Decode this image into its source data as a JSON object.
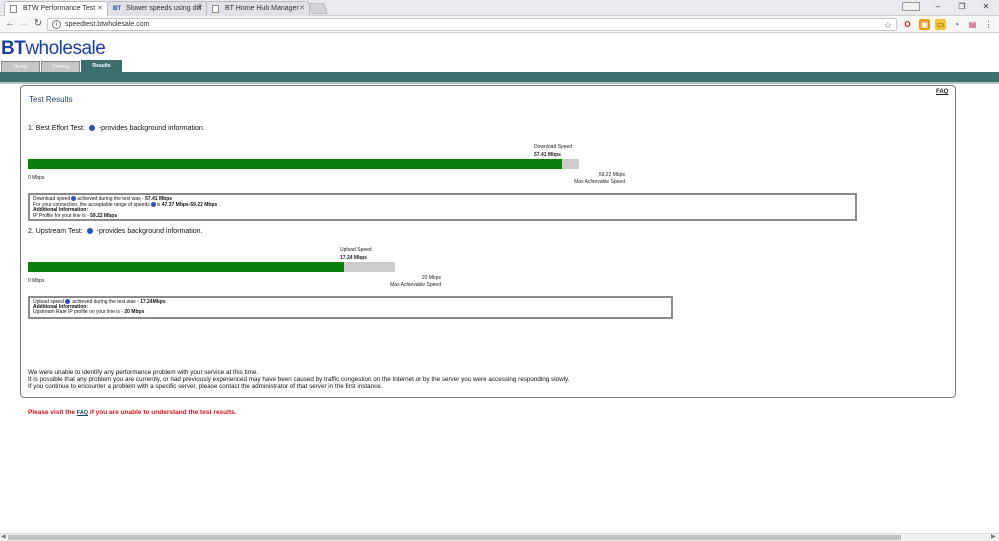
{
  "browser": {
    "tabs": [
      {
        "title": "BTW Performance Test",
        "favicon": "doc"
      },
      {
        "title": "Slower speeds using diff",
        "favicon": "BT"
      },
      {
        "title": "BT Home Hub Manager",
        "favicon": "doc"
      }
    ],
    "url": "speedtest.btwholesale.com"
  },
  "site": {
    "logo_bt": "BT",
    "logo_rest": "wholesale",
    "nav": [
      "Home",
      "Testing",
      "Results"
    ],
    "faq_top": "FAQ"
  },
  "results": {
    "title": "Test Results",
    "best_effort": {
      "heading": "1. Best Effort Test:",
      "heading_suffix": "-provides background information.",
      "speed_label": "Download Speed",
      "speed_value": "57.41 Mbps",
      "fill_fraction": 0.9688,
      "min_label": "0 Mbps",
      "max_value": "59.22 Mbps",
      "max_label": "Max Achievable Speed",
      "details": {
        "l1_pre": "Download speed",
        "l1_mid": "achieved during the test was - ",
        "l1_val": "57.41 Mbps",
        "l2_pre": "For your connection, the acceptable range of speeds",
        "l2_mid": "is ",
        "l2_val": "47.37 Mbps-59.22 Mbps",
        "l2_end": " .",
        "l3": "Additional Information:",
        "l4_pre": "IP Profile for your line is - ",
        "l4_val": "59.22 Mbps"
      }
    },
    "upstream": {
      "heading": "2. Upstream Test:",
      "heading_suffix": "-provides background information.",
      "speed_label": "Upload Speed",
      "speed_value": "17.24 Mbps",
      "fill_fraction": 0.862,
      "min_label": "0 Mbps",
      "max_value": "20 Mbps",
      "max_label": "Max Achievable Speed",
      "details": {
        "l1_pre": "Upload speed",
        "l1_mid": " achieved during the test was - ",
        "l1_val": "17.24Mbps",
        "l2": "Additional Information:",
        "l3_pre": "Upstream Rate IP profile on your line is - ",
        "l3_val": "20 Mbps"
      }
    },
    "message": {
      "line1": "We were unable to identify any performance problem with your service at this time.",
      "line2": "It is possible that any problem you are currently, or had previously experienced may have been caused by traffic congestion on the Internet or by the server you were accessing responding slowly.",
      "line3": "If you continue to encounter a problem with a specific server, please contact the administrator of that server in the first instance."
    },
    "warning": {
      "pre": "Please visit the ",
      "link": "FAQ",
      "post": " if you are unable to understand the test results."
    }
  },
  "colors": {
    "bar_fill": "#0a800a",
    "bar_track": "#cccccc",
    "teal": "#3d6f6f",
    "warning": "#d3141a",
    "logo": "#1b3fa0"
  }
}
